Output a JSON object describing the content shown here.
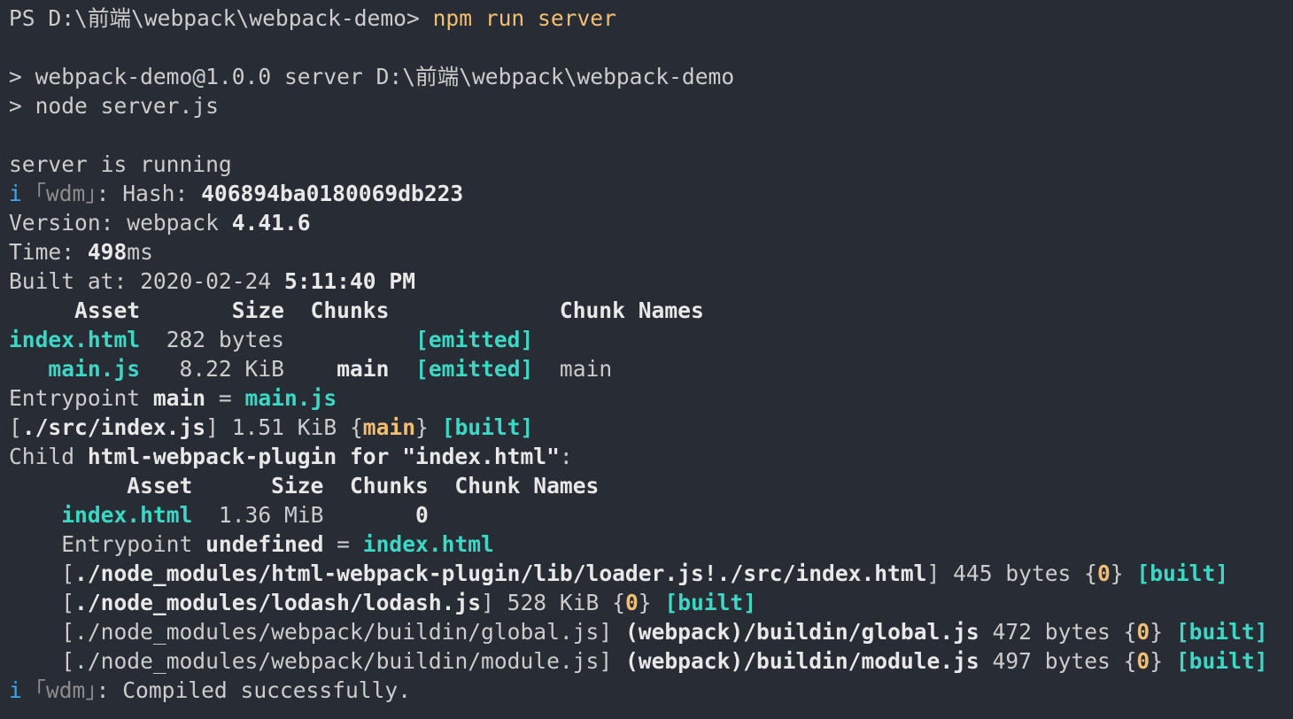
{
  "prompt": {
    "ps_path": "PS D:\\前端\\webpack\\webpack-demo> ",
    "command": "npm run server"
  },
  "script_echo": {
    "line1": "> webpack-demo@1.0.0 server D:\\前端\\webpack\\webpack-demo",
    "line2": "> node server.js"
  },
  "server_msg": "server is running",
  "wdm": {
    "info": "i",
    "tag": "｢wdm｣",
    "hash_label": ": Hash: ",
    "hash_value": "406894ba0180069db223",
    "compiled": ": Compiled successfully."
  },
  "build": {
    "version_label": "Version: webpack ",
    "version_value": "4.41.6",
    "time_label": "Time: ",
    "time_value": "498",
    "time_unit": "ms",
    "built_label": "Built at: 2020-02-24 ",
    "built_time": "5:11:40 PM"
  },
  "asset_table": {
    "header": "     Asset       Size  Chunks             Chunk Names",
    "rows": [
      {
        "indent": "",
        "asset": "index.html",
        "size": "  282 bytes          ",
        "chunk": "",
        "pad": "",
        "status": "[emitted]",
        "names": ""
      },
      {
        "indent": "   ",
        "asset": "main.js",
        "size": "   8.22 KiB    ",
        "chunk": "main",
        "pad": "  ",
        "status": "[emitted]",
        "names": "  main"
      }
    ]
  },
  "entrypoint": {
    "label": "Entrypoint ",
    "name": "main",
    "eq": " = ",
    "file": "main.js"
  },
  "module_line": {
    "open": "[",
    "path": "./src/index.js",
    "close": "] 1.51 KiB {",
    "chunk": "main",
    "close2": "} ",
    "status": "[built]"
  },
  "child": {
    "label": "Child ",
    "name": "html-webpack-plugin for \"index.html\"",
    "colon": ":",
    "header": "         Asset      Size  Chunks  Chunk Names",
    "asset_indent": "    ",
    "asset": "index.html",
    "asset_rest": "  1.36 MiB       ",
    "asset_chunk": "0",
    "entry_label": "    Entrypoint ",
    "entry_name": "undefined",
    "entry_eq": " = ",
    "entry_file": "index.html",
    "modules": [
      {
        "open": "    [",
        "path": "./node_modules/html-webpack-plugin/lib/loader.js!./src/index.html",
        "bold_path": true,
        "close": "]",
        "extra": "",
        "size": " 445 bytes {",
        "chunk": "0",
        "close2": "} ",
        "status": "[built]"
      },
      {
        "open": "    [",
        "path": "./node_modules/lodash/lodash.js",
        "bold_path": true,
        "close": "]",
        "extra": "",
        "size": " 528 KiB {",
        "chunk": "0",
        "close2": "} ",
        "status": "[built]"
      },
      {
        "open": "    [",
        "path": "./node_modules/webpack/buildin/global.js",
        "bold_path": false,
        "close": "] ",
        "extra": "(webpack)/buildin/global.js",
        "size": " 472 bytes {",
        "chunk": "0",
        "close2": "} ",
        "status": "[built]"
      },
      {
        "open": "    [",
        "path": "./node_modules/webpack/buildin/module.js",
        "bold_path": false,
        "close": "] ",
        "extra": "(webpack)/buildin/module.js",
        "size": " 497 bytes {",
        "chunk": "0",
        "close2": "} ",
        "status": "[built]"
      }
    ]
  },
  "colors": {
    "background": "#282c34",
    "text": "#cccccc",
    "cyan": "#3cd8c6",
    "yellow": "#f2bf72",
    "blue": "#3ea6ef",
    "cursor": "#ff4f8b"
  }
}
